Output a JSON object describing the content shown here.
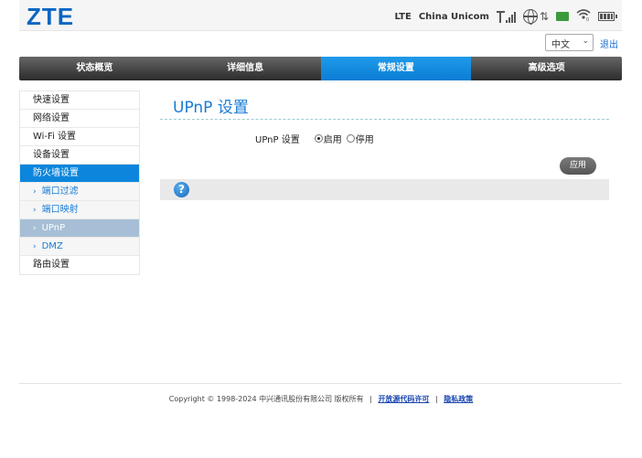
{
  "header": {
    "logo": "ZTE",
    "network_type": "LTE",
    "carrier": "China Unicom",
    "icons": [
      "signal-icon",
      "globe-icon",
      "data-arrows-icon",
      "sms-icon",
      "wifi-icon",
      "battery-icon"
    ],
    "arrows_glyph": "⇅",
    "wifi_glyph": "ᯤ",
    "wifi_count": "0"
  },
  "lang": {
    "selected": "中文",
    "logout": "退出"
  },
  "nav": {
    "tabs": [
      {
        "label": "状态概览"
      },
      {
        "label": "详细信息"
      },
      {
        "label": "常规设置",
        "active": true
      },
      {
        "label": "高级选项"
      }
    ]
  },
  "sidebar": {
    "items": [
      {
        "label": "快速设置"
      },
      {
        "label": "网络设置"
      },
      {
        "label": "Wi-Fi 设置"
      },
      {
        "label": "设备设置"
      },
      {
        "label": "防火墙设置",
        "active": true
      }
    ],
    "sub": [
      {
        "label": "端口过滤"
      },
      {
        "label": "端口映射"
      },
      {
        "label": "UPnP",
        "selected": true
      },
      {
        "label": "DMZ"
      }
    ],
    "last": "路由设置",
    "arrow": "›"
  },
  "main": {
    "title": "UPnP 设置",
    "setting_label": "UPnP 设置",
    "option_enable": "启用",
    "option_disable": "停用",
    "selected": "启用",
    "apply": "应用",
    "help": "?"
  },
  "footer": {
    "copyright": "Copyright © 1998-2024 中兴通讯股份有限公司 版权所有",
    "sep": "|",
    "link_open_source": "开放源代码许可",
    "link_privacy": "隐私政策"
  },
  "colors": {
    "accent": "#0c86dc",
    "logo": "#0a66c2",
    "nav_dark": "#2b2b2b"
  }
}
